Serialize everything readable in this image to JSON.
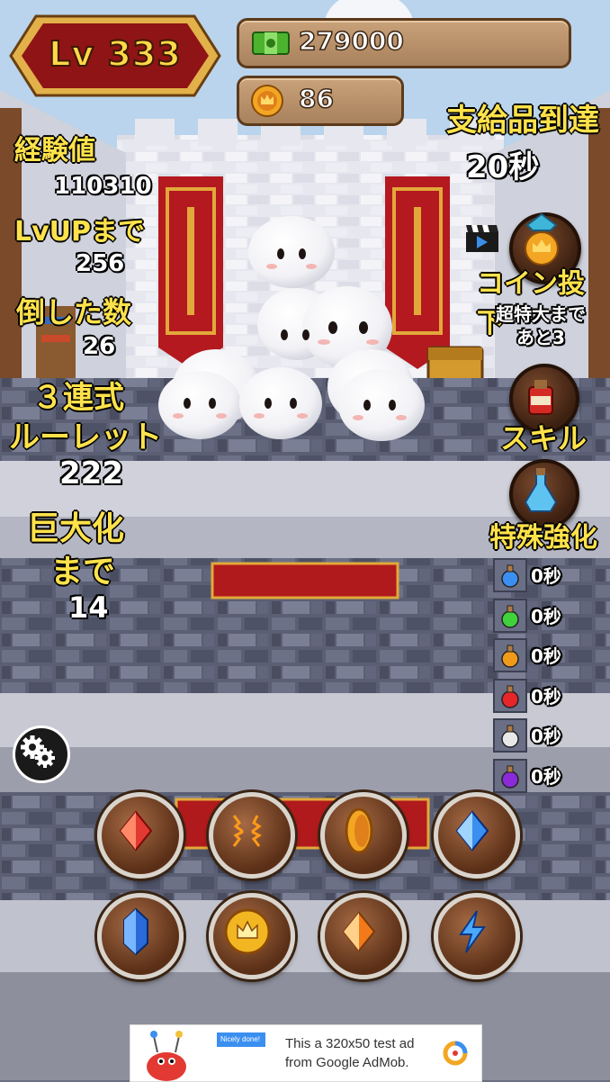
{
  "hud": {
    "level_label": "Lv 333",
    "money": "279000",
    "coins": "86"
  },
  "stats": {
    "exp_label": "経験値",
    "exp_value": "110310",
    "lvup_label": "LvUPまで",
    "lvup_value": "256",
    "killed_label": "倒した数",
    "killed_value": "26",
    "roulette_label_1": "３連式",
    "roulette_label_2": "ルーレット",
    "roulette_value": "222",
    "giant_label_1": "巨大化",
    "giant_label_2": "まで",
    "giant_value": "14"
  },
  "supply": {
    "title": "支給品到達",
    "timer": "20秒"
  },
  "right_panel": {
    "coin_drop_label": "コイン投下",
    "coin_drop_sub_1": "超特大まで",
    "coin_drop_sub_2": "あと3",
    "skill_label": "スキル",
    "special_label": "特殊強化"
  },
  "potions": [
    {
      "name": "blue-potion",
      "color": "#3a8ff0",
      "time": "0秒"
    },
    {
      "name": "green-potion",
      "color": "#3fd23a",
      "time": "0秒"
    },
    {
      "name": "orange-potion",
      "color": "#f09a1a",
      "time": "0秒"
    },
    {
      "name": "red-potion",
      "color": "#e8262a",
      "time": "0秒"
    },
    {
      "name": "white-potion",
      "color": "#e8e8e8",
      "time": "0秒"
    },
    {
      "name": "purple-potion",
      "color": "#8a2ad8",
      "time": "0秒"
    }
  ],
  "skills": [
    {
      "name": "red-crystal-icon"
    },
    {
      "name": "lightning-burst-icon"
    },
    {
      "name": "gold-coin-side-icon"
    },
    {
      "name": "blue-crystal-icon"
    },
    {
      "name": "blue-gem-icon"
    },
    {
      "name": "crown-coin-icon"
    },
    {
      "name": "orange-crystal-icon"
    },
    {
      "name": "lightning-bolt-icon"
    }
  ],
  "ad": {
    "line1": "This a 320x50 test ad",
    "line2": "from Google AdMob.",
    "badge": "Nicely done!"
  },
  "colors": {
    "accent_yellow": "#ffe24a",
    "level_red": "#8e1416",
    "gold_frame": "#e2b14a"
  }
}
